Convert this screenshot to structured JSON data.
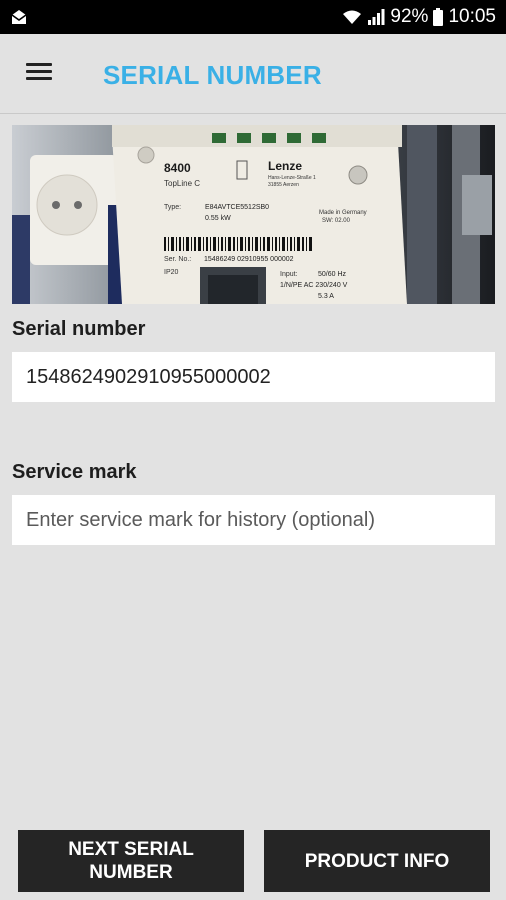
{
  "status_bar": {
    "battery": "92%",
    "time": "10:05",
    "icons": [
      "mail-icon",
      "wifi-icon",
      "signal-icon",
      "battery-icon"
    ]
  },
  "app_bar": {
    "title": "SERIAL NUMBER",
    "menu_icon": "hamburger-menu-icon"
  },
  "photo": {
    "model": "8400",
    "line": "TopLine C",
    "brand": "Lenze",
    "address_1": "Hans-Lenze-Straße 1",
    "address_2": "31855 Aerzen",
    "type_label": "Type:",
    "type_value": "E84AVTCE5512SB0",
    "power": "0.55 kW",
    "made_in": "Made in Germany",
    "sw": "SW:    02.00",
    "ser_label": "Ser. No.:",
    "ser_value": "15486249 02910955 000002",
    "ip": "IP20",
    "input_label": "Input:",
    "input_freq": "50/60 Hz",
    "input_volt": "1/N/PE AC 230/240 V",
    "input_amp": "5.3 A"
  },
  "serial_field": {
    "label": "Serial number",
    "value": "15486249029109550000​02"
  },
  "service_field": {
    "label": "Service mark",
    "placeholder": "Enter service mark for history (optional)"
  },
  "buttons": {
    "next_serial": "NEXT SERIAL NUMBER",
    "product_info": "PRODUCT INFO"
  },
  "colors": {
    "accent": "#3ab0e6",
    "button": "#252525",
    "background": "#e2e2e2"
  }
}
